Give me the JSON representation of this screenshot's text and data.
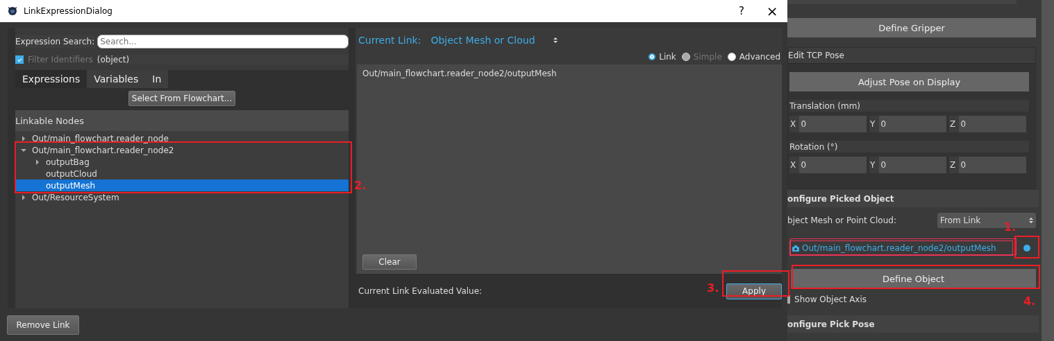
{
  "window": {
    "title": "LinkExpressionDialog",
    "help": "?",
    "close": "×"
  },
  "search": {
    "label": "Expression Search:",
    "placeholder": "Search..."
  },
  "filter": {
    "label": "Filter Identifiers",
    "checked": true,
    "value": "(object)"
  },
  "tabs": [
    {
      "label": "Expressions",
      "selected": true
    },
    {
      "label": "Variables",
      "selected": false
    },
    {
      "label": "In",
      "selected": false
    }
  ],
  "select_button": "Select From Flowchart...",
  "tree": {
    "header": "Linkable Nodes",
    "items": [
      {
        "label": "Out/main_flowchart.reader_node",
        "kind": "branch",
        "expanded": false,
        "selected": false
      },
      {
        "label": "Out/main_flowchart.reader_node2",
        "kind": "branch",
        "expanded": true,
        "selected": false,
        "children": [
          {
            "label": "outputBag",
            "kind": "branch",
            "expanded": false,
            "selected": false
          },
          {
            "label": "outputCloud",
            "kind": "leaf",
            "selected": false
          },
          {
            "label": "outputMesh",
            "kind": "leaf",
            "selected": true
          }
        ]
      },
      {
        "label": "Out/ResourceSystem",
        "kind": "branch",
        "expanded": false,
        "selected": false
      }
    ]
  },
  "current_link": {
    "label": "Current Link:",
    "value": "Object Mesh or Cloud"
  },
  "modes": [
    {
      "label": "Link",
      "selected": true,
      "disabled": false
    },
    {
      "label": "Simple",
      "selected": false,
      "disabled": true
    },
    {
      "label": "Advanced",
      "selected": false,
      "disabled": false
    }
  ],
  "expression": "Out/main_flowchart.reader_node2/outputMesh",
  "clear_button": "Clear",
  "evaluated_label": "Current Link Evaluated Value:",
  "apply_button": "Apply",
  "remove_button": "Remove Link",
  "side": {
    "define_gripper": "Define Gripper",
    "tcp_title": "Edit TCP Pose",
    "adjust_button": "Adjust Pose on Display",
    "translation_label": "Translation (mm)",
    "translation": [
      {
        "axis": "X",
        "value": "0"
      },
      {
        "axis": "Y",
        "value": "0"
      },
      {
        "axis": "Z",
        "value": "0"
      }
    ],
    "rotation_label": "Rotation (°)",
    "rotation": [
      {
        "axis": "X",
        "value": "0"
      },
      {
        "axis": "Y",
        "value": "0"
      },
      {
        "axis": "Z",
        "value": "0"
      }
    ],
    "picked_title": "onfigure Picked Object",
    "mesh_label": "bject Mesh or Point Cloud:",
    "mesh_source": "From Link",
    "link_value": "Out/main_flowchart.reader_node2/outputMesh",
    "define_object": "Define Object",
    "show_axis": {
      "label": "Show Object Axis",
      "checked": false
    },
    "pick_pose_title": "onfigure Pick Pose"
  },
  "annotations": [
    {
      "label": "1."
    },
    {
      "label": "2."
    },
    {
      "label": "3."
    },
    {
      "label": "4."
    }
  ]
}
